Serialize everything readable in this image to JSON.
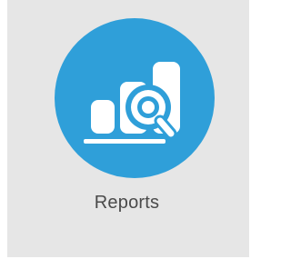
{
  "tile": {
    "label": "Reports",
    "icon": "reports-chart-magnifier-icon",
    "accent_color": "#2f9fd9",
    "background_color": "#e6e6e6"
  }
}
